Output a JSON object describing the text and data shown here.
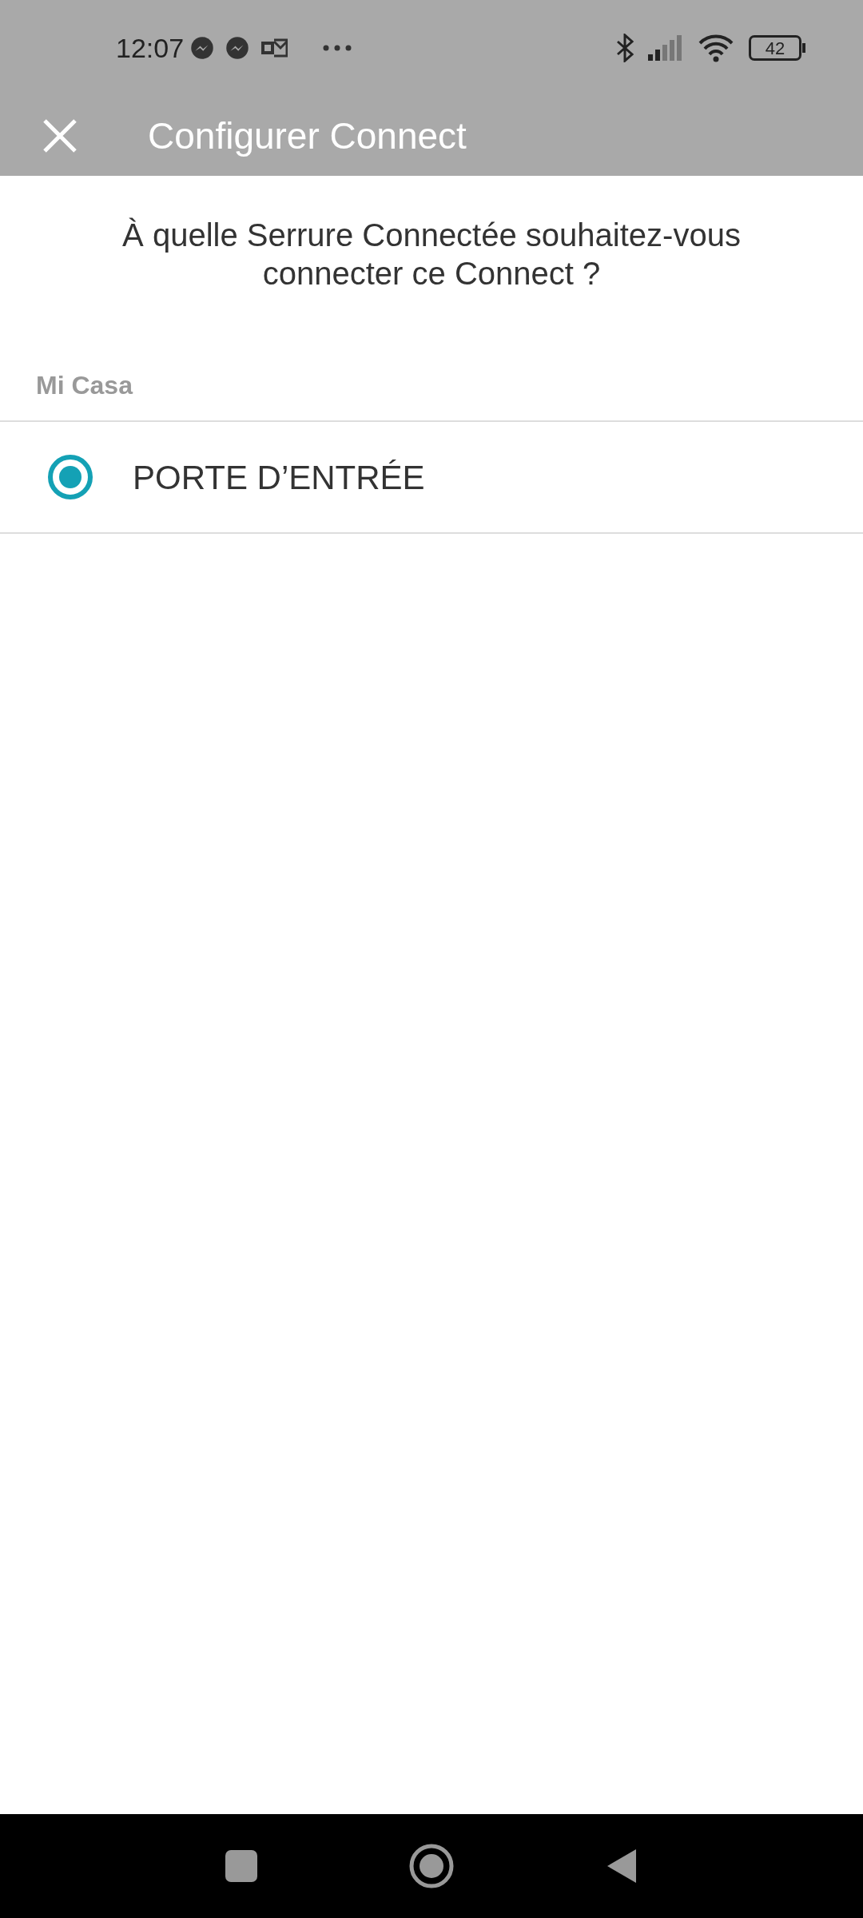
{
  "status_bar": {
    "time": "12:07",
    "battery": "42"
  },
  "app_bar": {
    "title": "Configurer Connect"
  },
  "question": "À quelle Serrure Connectée souhaitez-vous connecter ce Connect ?",
  "section": {
    "title": "Mi Casa",
    "items": [
      {
        "label": "PORTE D’ENTRÉE",
        "selected": true
      }
    ]
  }
}
